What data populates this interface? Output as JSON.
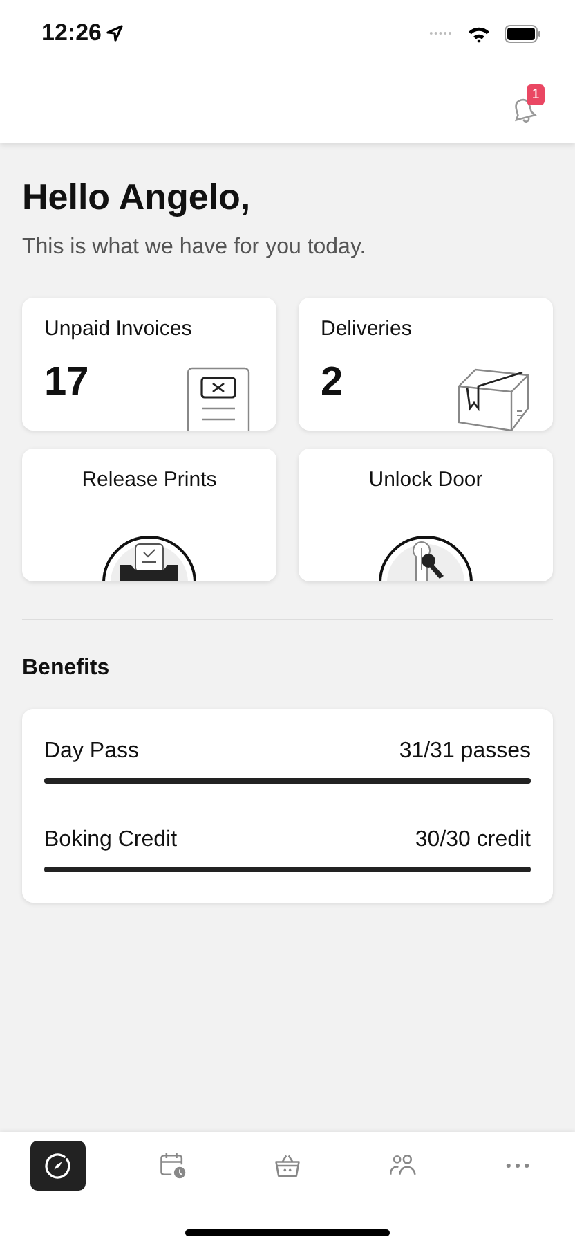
{
  "status_bar": {
    "time": "12:26"
  },
  "notifications": {
    "badge": "1"
  },
  "greeting": {
    "title": "Hello Angelo,",
    "subtitle": "This is what we have for you today."
  },
  "stat_cards": [
    {
      "label": "Unpaid Invoices",
      "value": "17",
      "kind": "invoice"
    },
    {
      "label": "Deliveries",
      "value": "2",
      "kind": "package"
    }
  ],
  "action_cards": [
    {
      "label": "Release Prints",
      "kind": "print"
    },
    {
      "label": "Unlock Door",
      "kind": "key"
    }
  ],
  "benefits": {
    "title": "Benefits",
    "items": [
      {
        "name": "Day Pass",
        "reading": "31/31 passes",
        "level": 1
      },
      {
        "name": "Boking Credit",
        "reading": "30/30 credit",
        "level": 1
      }
    ]
  },
  "tab_bar": [
    {
      "kind": "explore",
      "selected": true
    },
    {
      "kind": "calendar",
      "selected": false
    },
    {
      "kind": "basket",
      "selected": false
    },
    {
      "kind": "people",
      "selected": false
    },
    {
      "kind": "more",
      "selected": false
    }
  ]
}
